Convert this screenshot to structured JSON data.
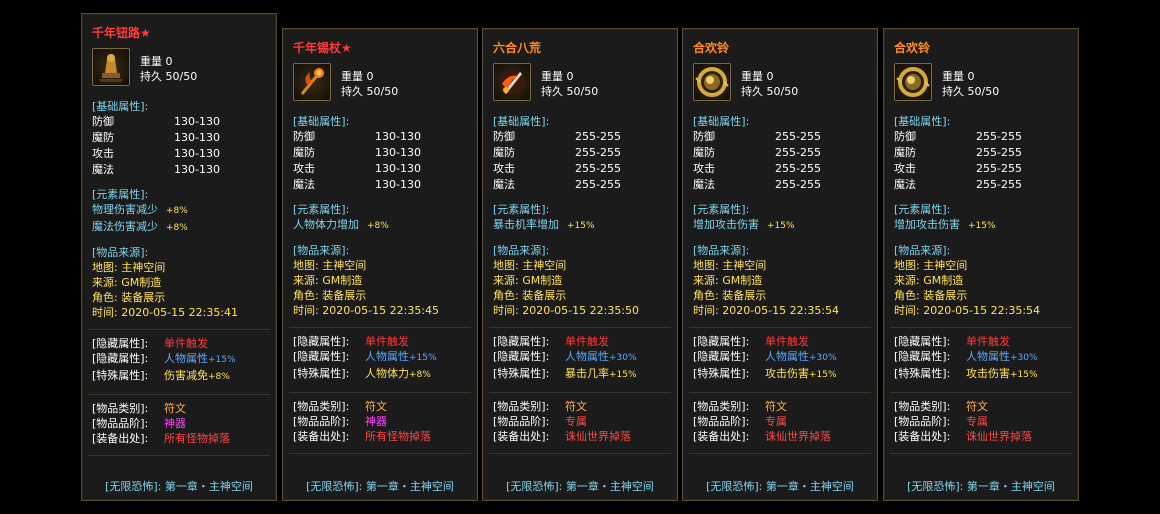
{
  "labels": {
    "weight": "重量",
    "durability": "持久",
    "base_header": "[基础属性]:",
    "element_header": "[元素属性]:",
    "source_header": "[物品来源]:",
    "hidden": "[隐藏属性]:",
    "hidden2": "[隐藏属性]:",
    "special": "[特殊属性]:",
    "category": "[物品类别]:",
    "grade": "[物品品阶]:",
    "drop": "[装备出处]:",
    "map": "地图:",
    "origin": "来源:",
    "role": "角色:",
    "time": "时间:",
    "footer_tag": "[无限恐怖]:",
    "footer_text": "第一章・主神空间"
  },
  "colors": {
    "panel_bg": "#1c1b1b",
    "border": "#5a4a2c",
    "title_red": "#ff3a3a",
    "title_orange": "#ff8c1a",
    "cyan": "#7fd4ee",
    "yellow": "#ffe25a",
    "blue": "#5aa8ff",
    "magenta": "#ff40ff"
  },
  "cards": [
    {
      "title": "千年钮路★",
      "title_color": "#ff3a3a",
      "icon": "golden-idol-icon",
      "weight": "0",
      "durability": "50/50",
      "base": [
        {
          "k": "防御",
          "v": "130-130"
        },
        {
          "k": "魔防",
          "v": "130-130"
        },
        {
          "k": "攻击",
          "v": "130-130"
        },
        {
          "k": "魔法",
          "v": "130-130"
        }
      ],
      "elements": [
        {
          "k": "物理伤害减少",
          "v": "+8%"
        },
        {
          "k": "魔法伤害减少",
          "v": "+8%"
        }
      ],
      "map": "主神空间",
      "origin": "GM制造",
      "role": "装备展示",
      "time": "2020-05-15 22:35:41",
      "hidden_val": "单件触发",
      "hidden2_val": "人物属性",
      "hidden2_pct": "+15%",
      "special_val": "伤害减免",
      "special_pct": "+8%",
      "category": "符文",
      "grade": "神器",
      "grade_color": "#ff40ff",
      "drop": "所有怪物掉落"
    },
    {
      "title": "千年锡杖★",
      "title_color": "#ff3a3a",
      "icon": "flame-staff-icon",
      "weight": "0",
      "durability": "50/50",
      "base": [
        {
          "k": "防御",
          "v": "130-130"
        },
        {
          "k": "魔防",
          "v": "130-130"
        },
        {
          "k": "攻击",
          "v": "130-130"
        },
        {
          "k": "魔法",
          "v": "130-130"
        }
      ],
      "elements": [
        {
          "k": "人物体力增加",
          "v": "+8%"
        }
      ],
      "map": "主神空间",
      "origin": "GM制造",
      "role": "装备展示",
      "time": "2020-05-15 22:35:45",
      "hidden_val": "单件触发",
      "hidden2_val": "人物属性",
      "hidden2_pct": "+15%",
      "special_val": "人物体力",
      "special_pct": "+8%",
      "category": "符文",
      "grade": "神器",
      "grade_color": "#ff40ff",
      "drop": "所有怪物掉落"
    },
    {
      "title": "六合八荒",
      "title_color": "#ff8c1a",
      "icon": "flame-blade-icon",
      "weight": "0",
      "durability": "50/50",
      "base": [
        {
          "k": "防御",
          "v": "255-255"
        },
        {
          "k": "魔防",
          "v": "255-255"
        },
        {
          "k": "攻击",
          "v": "255-255"
        },
        {
          "k": "魔法",
          "v": "255-255"
        }
      ],
      "elements": [
        {
          "k": "暴击机率增加",
          "v": "+15%"
        }
      ],
      "map": "主神空间",
      "origin": "GM制造",
      "role": "装备展示",
      "time": "2020-05-15 22:35:50",
      "hidden_val": "单件触发",
      "hidden2_val": "人物属性",
      "hidden2_pct": "+30%",
      "special_val": "暴击几率",
      "special_pct": "+15%",
      "category": "符文",
      "grade": "专属",
      "grade_color": "#ff4848",
      "drop": "诛仙世界掉落"
    },
    {
      "title": "合欢铃",
      "title_color": "#ff8c1a",
      "icon": "golden-ring-icon",
      "weight": "0",
      "durability": "50/50",
      "base": [
        {
          "k": "防御",
          "v": "255-255"
        },
        {
          "k": "魔防",
          "v": "255-255"
        },
        {
          "k": "攻击",
          "v": "255-255"
        },
        {
          "k": "魔法",
          "v": "255-255"
        }
      ],
      "elements": [
        {
          "k": "增加攻击伤害",
          "v": "+15%"
        }
      ],
      "map": "主神空间",
      "origin": "GM制造",
      "role": "装备展示",
      "time": "2020-05-15 22:35:54",
      "hidden_val": "单件触发",
      "hidden2_val": "人物属性",
      "hidden2_pct": "+30%",
      "special_val": "攻击伤害",
      "special_pct": "+15%",
      "category": "符文",
      "grade": "专属",
      "grade_color": "#ff4848",
      "drop": "诛仙世界掉落"
    },
    {
      "title": "合欢铃",
      "title_color": "#ff8c1a",
      "icon": "golden-ring-icon",
      "weight": "0",
      "durability": "50/50",
      "base": [
        {
          "k": "防御",
          "v": "255-255"
        },
        {
          "k": "魔防",
          "v": "255-255"
        },
        {
          "k": "攻击",
          "v": "255-255"
        },
        {
          "k": "魔法",
          "v": "255-255"
        }
      ],
      "elements": [
        {
          "k": "增加攻击伤害",
          "v": "+15%"
        }
      ],
      "map": "主神空间",
      "origin": "GM制造",
      "role": "装备展示",
      "time": "2020-05-15 22:35:54",
      "hidden_val": "单件触发",
      "hidden2_val": "人物属性",
      "hidden2_pct": "+30%",
      "special_val": "攻击伤害",
      "special_pct": "+15%",
      "category": "符文",
      "grade": "专属",
      "grade_color": "#ff4848",
      "drop": "诛仙世界掉落"
    }
  ]
}
